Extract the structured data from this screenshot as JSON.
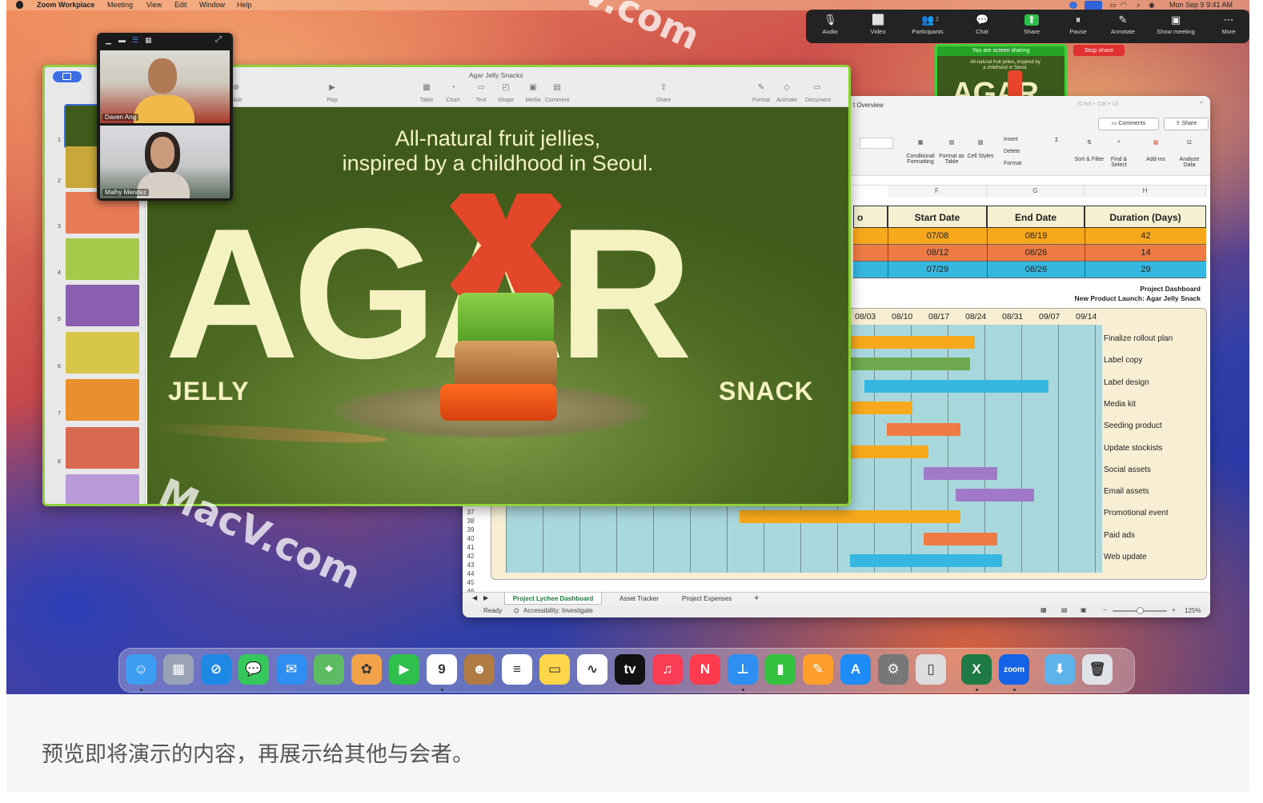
{
  "menubar": {
    "app": "Zoom Workplace",
    "items": [
      "Meeting",
      "View",
      "Edit",
      "Window",
      "Help"
    ],
    "clock": "Mon Sep 9  9:41 AM"
  },
  "zoom_toolbar": {
    "items": [
      {
        "label": "Audio",
        "icon": "microphone-icon",
        "glyph": "🎙"
      },
      {
        "label": "Video",
        "icon": "video-camera-icon",
        "glyph": "⬜"
      },
      {
        "label": "Participants",
        "icon": "participants-icon",
        "glyph": "👥",
        "badge": "2"
      },
      {
        "label": "Chat",
        "icon": "chat-icon",
        "glyph": "💬"
      },
      {
        "label": "Share",
        "icon": "share-screen-icon",
        "glyph": "⬆"
      },
      {
        "label": "Pause",
        "icon": "pause-icon",
        "glyph": "⏸"
      },
      {
        "label": "Annotate",
        "icon": "annotate-pen-icon",
        "glyph": "✎"
      },
      {
        "label": "Show meeting",
        "icon": "show-meeting-icon",
        "glyph": "▣"
      },
      {
        "label": "More",
        "icon": "more-icon",
        "glyph": "⋯"
      }
    ]
  },
  "share_preview": {
    "banner": "You are screen sharing",
    "headline": "All-natural fruit jellies, inspired by a childhood in Seoul.",
    "title": "AGAR",
    "stop_label": "Stop share"
  },
  "excel": {
    "view_label": "t Overview",
    "search_hint": "(Cmd + Ctrl + U)",
    "comments": "Comments",
    "share": "Share",
    "ribbon": [
      "Conditional Formatting",
      "Format as Table",
      "Cell Styles",
      "Insert",
      "Delete",
      "Format",
      "Sort & Filter",
      "Find & Select",
      "Add-ins",
      "Analyze Data"
    ],
    "columns": [
      "F",
      "G",
      "H"
    ],
    "headers": [
      "o",
      "Start Date",
      "End Date",
      "Duration (Days)"
    ],
    "rows": [
      {
        "start": "07/08",
        "end": "08/19",
        "days": "42",
        "color": "#f7a81b"
      },
      {
        "start": "08/12",
        "end": "08/26",
        "days": "14",
        "color": "#ee7b43"
      },
      {
        "start": "07/29",
        "end": "08/26",
        "days": "29",
        "color": "#35b7e0"
      }
    ],
    "dashboard_title": "Project Dashboard",
    "dashboard_sub": "New Product Launch: Agar Jelly Snack",
    "gantt_dates": [
      "08/03",
      "08/10",
      "08/17",
      "08/24",
      "08/31",
      "09/07",
      "09/14"
    ],
    "tasks": [
      "Finalize rollout plan",
      "Label copy",
      "Label design",
      "Media kit",
      "Seeding product",
      "Update stockists",
      "Social assets",
      "Email assets",
      "Promotional event",
      "Paid ads",
      "Web update"
    ],
    "row_numbers": [
      "37",
      "38",
      "39",
      "40",
      "41",
      "42",
      "43",
      "44",
      "45",
      "46"
    ],
    "sheet_tabs": [
      "Project Lychee Dashboard",
      "Asset Tracker",
      "Project Expenses"
    ],
    "add_sheet": "+",
    "status_ready": "Ready",
    "accessibility": "Accessibility: Investigate",
    "zoom": "125%"
  },
  "keynote": {
    "window_title": "Agar Jelly Snacks",
    "toolbar": [
      "Slide",
      "Play",
      "Table",
      "Chart",
      "Text",
      "Shape",
      "Media",
      "Comment",
      "Share",
      "Format",
      "Animate",
      "Document"
    ],
    "slide_numbers": [
      "1",
      "2",
      "3",
      "4",
      "5",
      "6",
      "7",
      "8"
    ],
    "slide": {
      "headline_line1": "All-natural fruit jellies,",
      "headline_line2": "inspired by a childhood in Seoul.",
      "title": "AGAR",
      "left_word": "JELLY",
      "right_word": "SNACK"
    }
  },
  "video": {
    "participants": [
      "Daven Ang",
      "Malhy Mendez"
    ]
  },
  "dock": {
    "apps": [
      {
        "name": "Finder",
        "icon": "finder-icon",
        "color": "#3d9df2",
        "glyph": "☺"
      },
      {
        "name": "Launchpad",
        "icon": "launchpad-icon",
        "color": "#9aa3b5",
        "glyph": "▦"
      },
      {
        "name": "Safari",
        "icon": "safari-icon",
        "color": "#1e88e5",
        "glyph": "⊘"
      },
      {
        "name": "Messages",
        "icon": "messages-icon",
        "color": "#35c759",
        "glyph": "💬"
      },
      {
        "name": "Mail",
        "icon": "mail-icon",
        "color": "#2f8ff0",
        "glyph": "✉"
      },
      {
        "name": "Maps",
        "icon": "maps-icon",
        "color": "#5dbb63",
        "glyph": "⌖"
      },
      {
        "name": "Photos",
        "icon": "photos-icon",
        "color": "#f2a34a",
        "glyph": "✿"
      },
      {
        "name": "FaceTime",
        "icon": "facetime-icon",
        "color": "#2fbf4a",
        "glyph": "▶"
      },
      {
        "name": "Calendar",
        "icon": "calendar-icon",
        "color": "#ffffff",
        "glyph": "9"
      },
      {
        "name": "Contacts",
        "icon": "contacts-icon",
        "color": "#b07a45",
        "glyph": "☻"
      },
      {
        "name": "Reminders",
        "icon": "reminders-icon",
        "color": "#ffffff",
        "glyph": "≡"
      },
      {
        "name": "Notes",
        "icon": "notes-icon",
        "color": "#ffd54a",
        "glyph": "▭"
      },
      {
        "name": "Freeform",
        "icon": "freeform-icon",
        "color": "#ffffff",
        "glyph": "∿"
      },
      {
        "name": "TV",
        "icon": "apple-tv-icon",
        "color": "#111111",
        "glyph": "tv"
      },
      {
        "name": "Music",
        "icon": "music-icon",
        "color": "#fa3d55",
        "glyph": "♫"
      },
      {
        "name": "News",
        "icon": "news-icon",
        "color": "#ff3b4d",
        "glyph": "N"
      },
      {
        "name": "Keynote",
        "icon": "keynote-icon",
        "color": "#2f8ff0",
        "glyph": "⊥"
      },
      {
        "name": "Numbers",
        "icon": "numbers-icon",
        "color": "#33c23f",
        "glyph": "▮"
      },
      {
        "name": "Pages",
        "icon": "pages-icon",
        "color": "#ff9e2b",
        "glyph": "✎"
      },
      {
        "name": "App Store",
        "icon": "app-store-icon",
        "color": "#1f8cf5",
        "glyph": "A"
      },
      {
        "name": "System Settings",
        "icon": "settings-gear-icon",
        "color": "#777777",
        "glyph": "⚙"
      },
      {
        "name": "iPhone Mirroring",
        "icon": "iphone-mirroring-icon",
        "color": "#dddddd",
        "glyph": "▯"
      },
      {
        "name": "Excel",
        "icon": "excel-icon",
        "color": "#1f7a46",
        "glyph": "X"
      },
      {
        "name": "Zoom",
        "icon": "zoom-icon",
        "color": "#1463e6",
        "glyph": "zoom"
      },
      {
        "name": "Downloads",
        "icon": "downloads-folder-icon",
        "color": "#5fb3ec",
        "glyph": "⬇"
      },
      {
        "name": "Trash",
        "icon": "trash-icon",
        "color": "#dfe3e8",
        "glyph": "🗑"
      }
    ]
  },
  "watermarks": [
    "MacV.com",
    "V.com"
  ],
  "caption": "预览即将演示的内容，再展示给其他与会者。"
}
